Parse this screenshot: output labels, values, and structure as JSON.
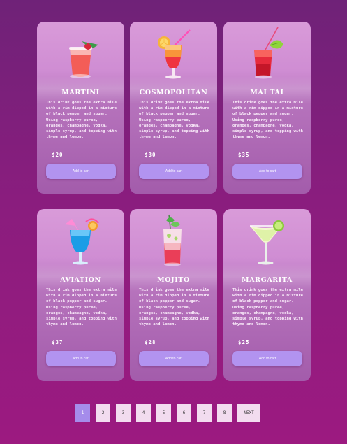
{
  "cards": [
    {
      "name": "MARTINI",
      "desc": "This drink goes the extra mile with a rim dipped in a mixture of black pepper and sugar. Using raspberry puree, oranges, champagne, vodka, simple syrup, and topping with thyme and lemon.",
      "price": "$20",
      "button": "Add to cart",
      "icon": "martini-drink-icon"
    },
    {
      "name": "COSMOPOLITAN",
      "desc": "This drink goes the extra mile with a rim dipped in a mixture of black pepper and sugar. Using raspberry puree, oranges, champagne, vodka, simple syrup, and topping with thyme and lemon.",
      "price": "$30",
      "button": "Add to cart",
      "icon": "cosmopolitan-drink-icon"
    },
    {
      "name": "MAI TAI",
      "desc": "This drink goes the extra mile with a rim dipped in a mixture of black pepper and sugar. Using raspberry puree, oranges, champagne, vodka, simple syrup, and topping with thyme and lemon.",
      "price": "$35",
      "button": "Add to cart",
      "icon": "mai-tai-drink-icon"
    },
    {
      "name": "AVIATION",
      "desc": "This drink goes the extra mile with a rim dipped in a mixture of black pepper and sugar. Using raspberry puree, oranges, champagne, vodka, simple syrup, and topping with thyme and lemon.",
      "price": "$37",
      "button": "Add to cart",
      "icon": "aviation-drink-icon"
    },
    {
      "name": "MOJITO",
      "desc": "This drink goes the extra mile with a rim dipped in a mixture of black pepper and sugar. Using raspberry puree, oranges, champagne, vodka, simple syrup, and topping with thyme and lemon.",
      "price": "$28",
      "button": "Add to cart",
      "icon": "mojito-drink-icon"
    },
    {
      "name": "MARGARITA",
      "desc": "This drink goes the extra mile with a rim dipped in a mixture of black pepper and sugar. Using raspberry puree, oranges, champagne, vodka, simple syrup, and topping with thyme and lemon.",
      "price": "$25",
      "button": "Add to cart",
      "icon": "margarita-drink-icon"
    }
  ],
  "pagination": {
    "pages": [
      "1",
      "2",
      "3",
      "4",
      "5",
      "6",
      "7",
      "8"
    ],
    "active": "1",
    "next": "NEXT"
  },
  "colors": {
    "accent": "#a58ceb",
    "button": "#b293f0",
    "page_bg": "#f2dcef"
  }
}
